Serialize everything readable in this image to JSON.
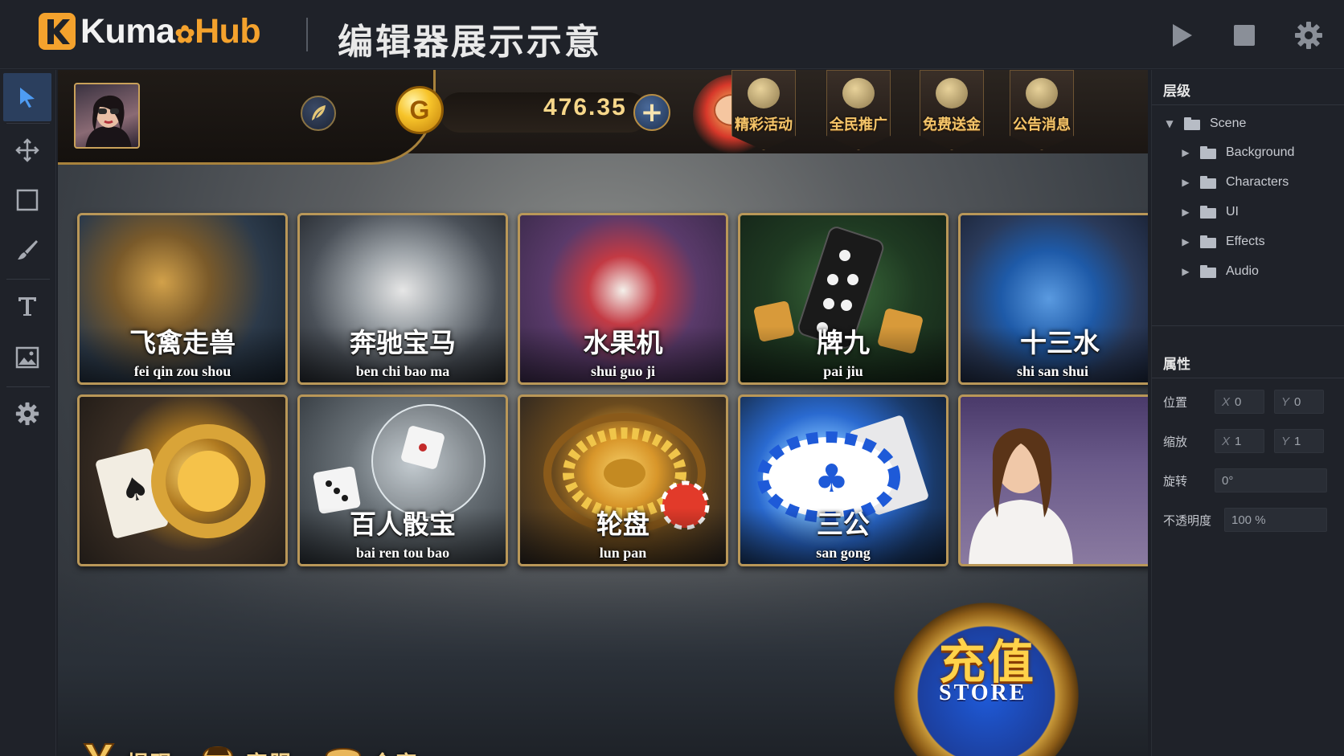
{
  "app": {
    "logo_text_a": "Kuma",
    "logo_text_b": "Hub",
    "title": "编辑器展示示意"
  },
  "top_controls": [
    {
      "name": "play-button",
      "icon": "play-icon"
    },
    {
      "name": "stop-button",
      "icon": "stop-icon"
    },
    {
      "name": "settings-button",
      "icon": "gear-icon"
    }
  ],
  "left_tools": [
    {
      "name": "select-tool",
      "icon": "cursor-icon",
      "active": true
    },
    {
      "name": "move-tool",
      "icon": "move-arrows-icon"
    },
    {
      "name": "rect-tool",
      "icon": "rectangle-icon"
    },
    {
      "name": "brush-tool",
      "icon": "brush-icon"
    },
    {
      "name": "text-tool",
      "icon": "text-icon"
    },
    {
      "name": "image-tool",
      "icon": "image-icon"
    },
    {
      "name": "settings-tool",
      "icon": "gear-icon"
    }
  ],
  "game": {
    "balance": "476.35",
    "coin_symbol": "G",
    "promos": [
      {
        "label": "精彩活动",
        "icon": "treasure-chest-icon"
      },
      {
        "label": "全民推广",
        "icon": "coin-stack-icon"
      },
      {
        "label": "免费送金",
        "icon": "money-bag-icon"
      },
      {
        "label": "公告消息",
        "icon": "chat-bubble-icon"
      }
    ],
    "tiles": [
      {
        "cn": "飞禽走兽",
        "py": "fei qin zou shou"
      },
      {
        "cn": "奔驰宝马",
        "py": "ben chi bao ma"
      },
      {
        "cn": "水果机",
        "py": "shui guo ji"
      },
      {
        "cn": "牌九",
        "py": "pai jiu"
      },
      {
        "cn": "十三水",
        "py": "shi san shui"
      },
      {
        "cn": "",
        "py": ""
      },
      {
        "cn": "百人骰宝",
        "py": "bai ren tou bao"
      },
      {
        "cn": "轮盘",
        "py": "lun pan"
      },
      {
        "cn": "三公",
        "py": "san gong"
      },
      {
        "cn": "",
        "py": ""
      }
    ],
    "bottom": [
      {
        "label": "提现",
        "icon": "yuan-icon"
      },
      {
        "label": "客服",
        "icon": "customer-service-icon"
      },
      {
        "label": "仓库",
        "icon": "chest-icon"
      }
    ],
    "store_cn": "充值",
    "store_en": "STORE"
  },
  "hierarchy": {
    "title": "层级",
    "root": "Scene",
    "children": [
      "Background",
      "Characters",
      "UI",
      "Effects",
      "Audio"
    ]
  },
  "properties": {
    "title": "属性",
    "position_label": "位置",
    "position_x": "0",
    "position_y": "0",
    "scale_label": "缩放",
    "scale_x": "1",
    "scale_y": "1",
    "rotation_label": "旋转",
    "rotation_value": "0°",
    "opacity_label": "不透明度",
    "opacity_value": "100 %",
    "axis_x": "X",
    "axis_y": "Y"
  }
}
